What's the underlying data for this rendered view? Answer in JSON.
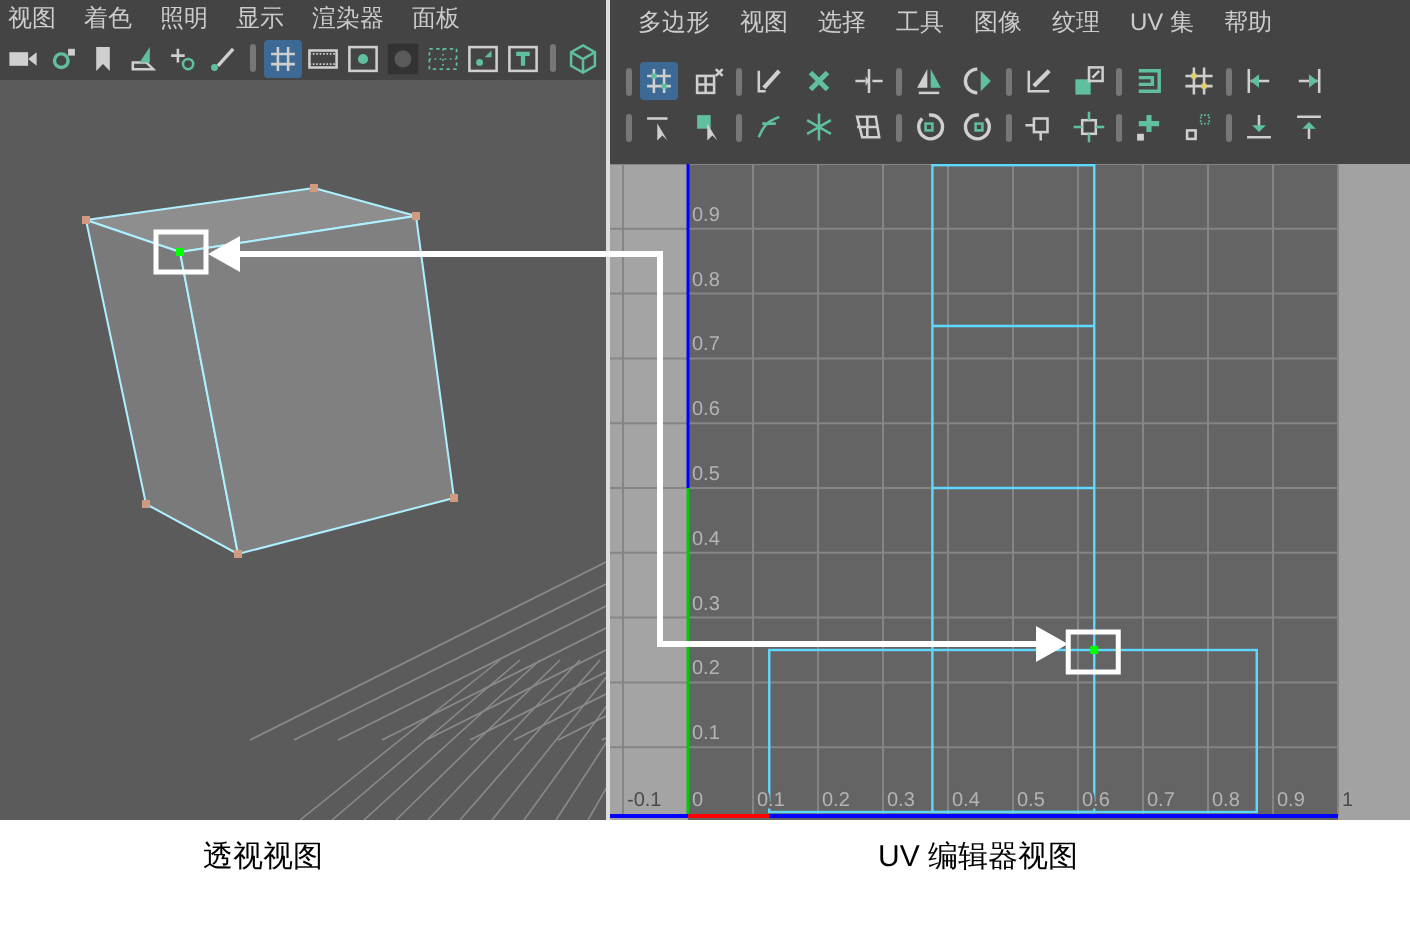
{
  "perspective_panel": {
    "menu": [
      "视图",
      "着色",
      "照明",
      "显示",
      "渲染器",
      "面板"
    ],
    "toolbar": [
      {
        "selected": false
      },
      {
        "selected": false
      },
      {
        "selected": false
      },
      {
        "selected": false
      },
      {
        "selected": false
      },
      {
        "selected": false
      },
      {
        "selected": true
      },
      {
        "selected": false
      },
      {
        "selected": false
      },
      {
        "selected": false
      },
      {
        "selected": false
      },
      {
        "selected": false
      },
      {
        "selected": false
      },
      {
        "selected": false
      }
    ]
  },
  "uv_panel": {
    "menu": [
      "多边形",
      "视图",
      "选择",
      "工具",
      "图像",
      "纹理",
      "UV 集",
      "帮助"
    ],
    "toolbar_rows": [
      [
        {
          "selected": true
        },
        {
          "selected": false
        },
        {
          "selected": false
        },
        {
          "selected": false
        },
        {
          "selected": false
        },
        {
          "selected": false
        },
        {
          "selected": false
        },
        {
          "selected": false
        },
        {
          "selected": false
        },
        {
          "selected": false
        },
        {
          "selected": false
        },
        {
          "selected": false
        },
        {
          "selected": false
        }
      ],
      [
        {
          "selected": false
        },
        {
          "selected": false
        },
        {
          "selected": false
        },
        {
          "selected": false
        },
        {
          "selected": false
        },
        {
          "selected": false
        },
        {
          "selected": false
        },
        {
          "selected": false
        },
        {
          "selected": false
        },
        {
          "selected": false
        },
        {
          "selected": false
        },
        {
          "selected": false
        },
        {
          "selected": false
        }
      ]
    ],
    "u_labels": [
      "-0.1",
      "0",
      "0.1",
      "0.2",
      "0.3",
      "0.4",
      "0.5",
      "0.6",
      "0.7",
      "0.8",
      "0.9",
      "1"
    ],
    "v_labels": [
      "0.9",
      "0.8",
      "0.7",
      "0.6",
      "0.5",
      "0.4",
      "0.3",
      "0.2",
      "0.1"
    ]
  },
  "captions": [
    "透视视图",
    "UV 编辑器视图"
  ]
}
